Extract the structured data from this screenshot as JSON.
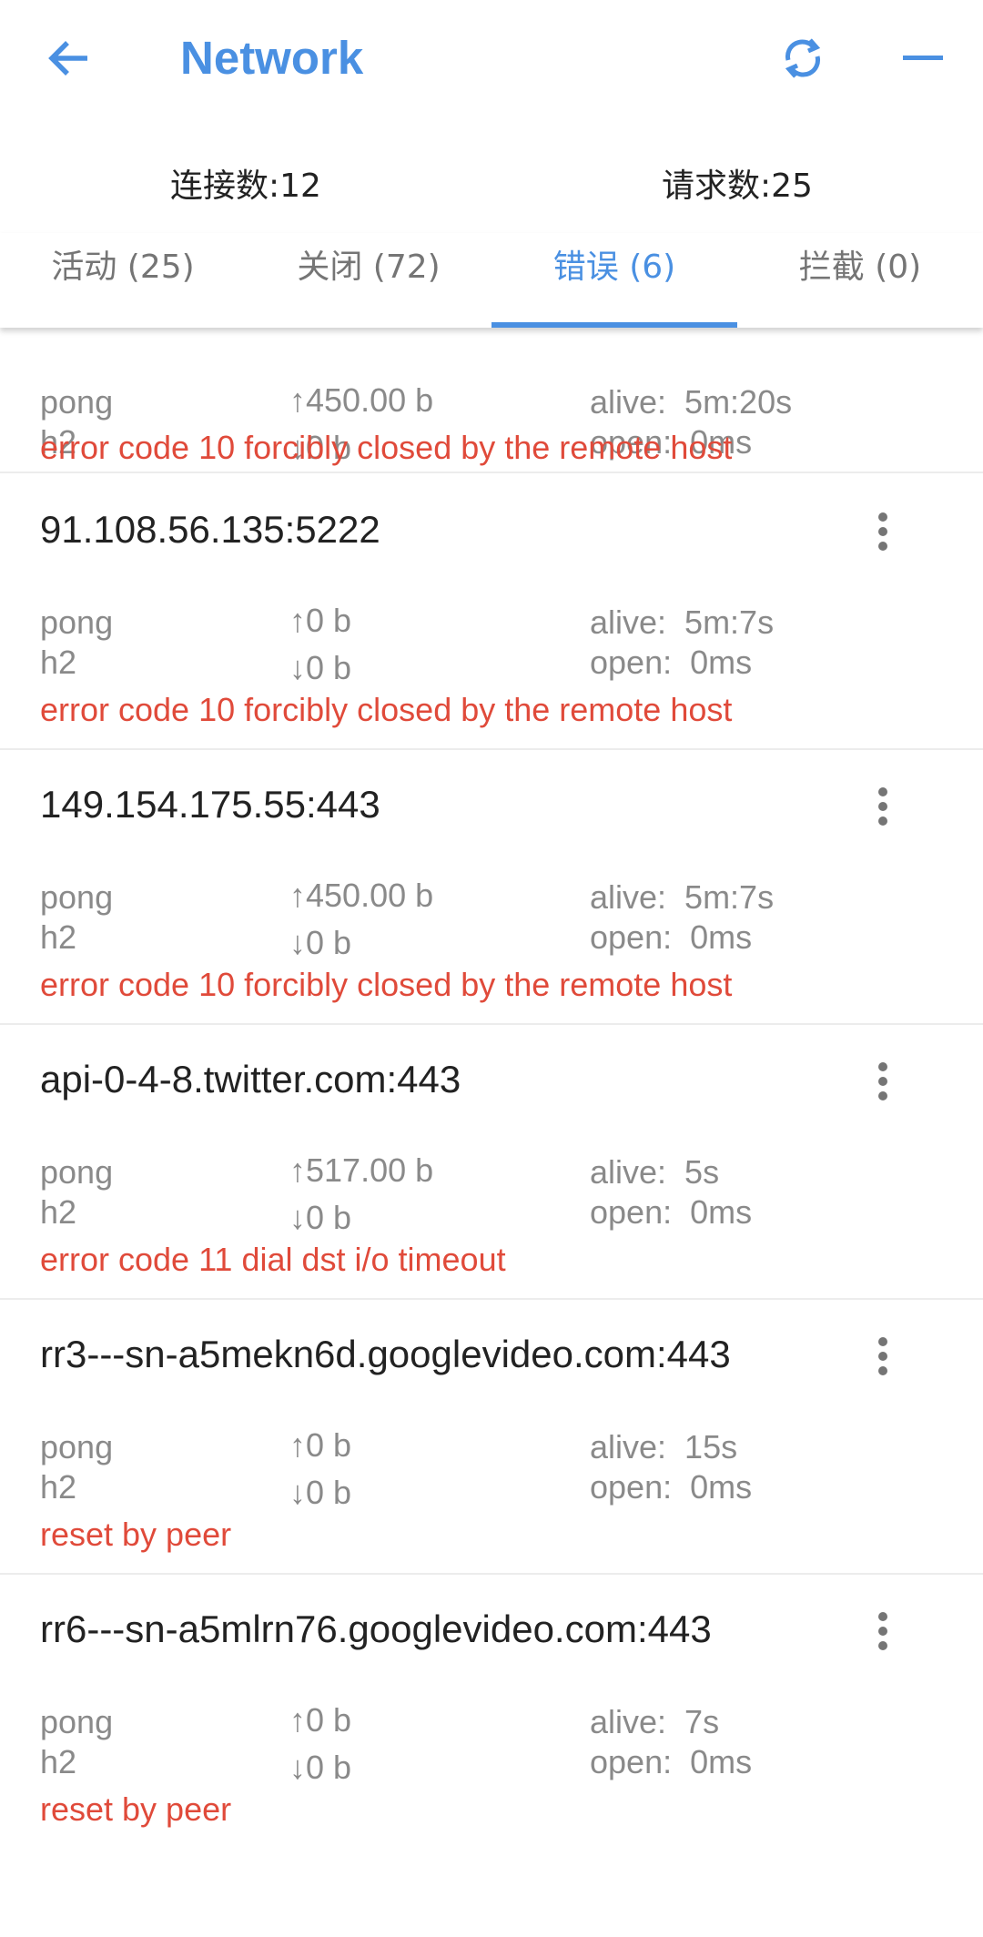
{
  "header": {
    "title": "Network"
  },
  "stats": {
    "connections": "连接数:12",
    "requests": "请求数:25"
  },
  "tabs": [
    {
      "label": "活动 (25)"
    },
    {
      "label": "关闭 (72)"
    },
    {
      "label": "错误 (6)"
    },
    {
      "label": "拦截 (0)"
    }
  ],
  "active_tab": 2,
  "connections": [
    {
      "host": "",
      "rule": "pong",
      "protocol": "h2",
      "up": "↑450.00 b",
      "down": "↓0 b",
      "alive": "alive:  5m:20s",
      "open": "open:  0ms",
      "error": "error code 10 forcibly closed by the remote host"
    },
    {
      "host": "91.108.56.135:5222",
      "rule": "pong",
      "protocol": "h2",
      "up": "↑0 b",
      "down": "↓0 b",
      "alive": "alive:  5m:7s",
      "open": "open:  0ms",
      "error": "error code 10 forcibly closed by the remote host"
    },
    {
      "host": "149.154.175.55:443",
      "rule": "pong",
      "protocol": "h2",
      "up": "↑450.00 b",
      "down": "↓0 b",
      "alive": "alive:  5m:7s",
      "open": "open:  0ms",
      "error": "error code 10 forcibly closed by the remote host"
    },
    {
      "host": "api-0-4-8.twitter.com:443",
      "rule": "pong",
      "protocol": "h2",
      "up": "↑517.00 b",
      "down": "↓0 b",
      "alive": "alive:  5s",
      "open": "open:  0ms",
      "error": "error code 11 dial dst i/o timeout"
    },
    {
      "host": "rr3---sn-a5mekn6d.googlevideo.com:443",
      "rule": "pong",
      "protocol": "h2",
      "up": "↑0 b",
      "down": "↓0 b",
      "alive": "alive:  15s",
      "open": "open:  0ms",
      "error": "reset by peer"
    },
    {
      "host": "rr6---sn-a5mlrn76.googlevideo.com:443",
      "rule": "pong",
      "protocol": "h2",
      "up": "↑0 b",
      "down": "↓0 b",
      "alive": "alive:  7s",
      "open": "open:  0ms",
      "error": "reset by peer"
    }
  ],
  "colors": {
    "accent": "#4a90e2",
    "error": "#e04a3a",
    "muted": "#8a8a8a"
  }
}
